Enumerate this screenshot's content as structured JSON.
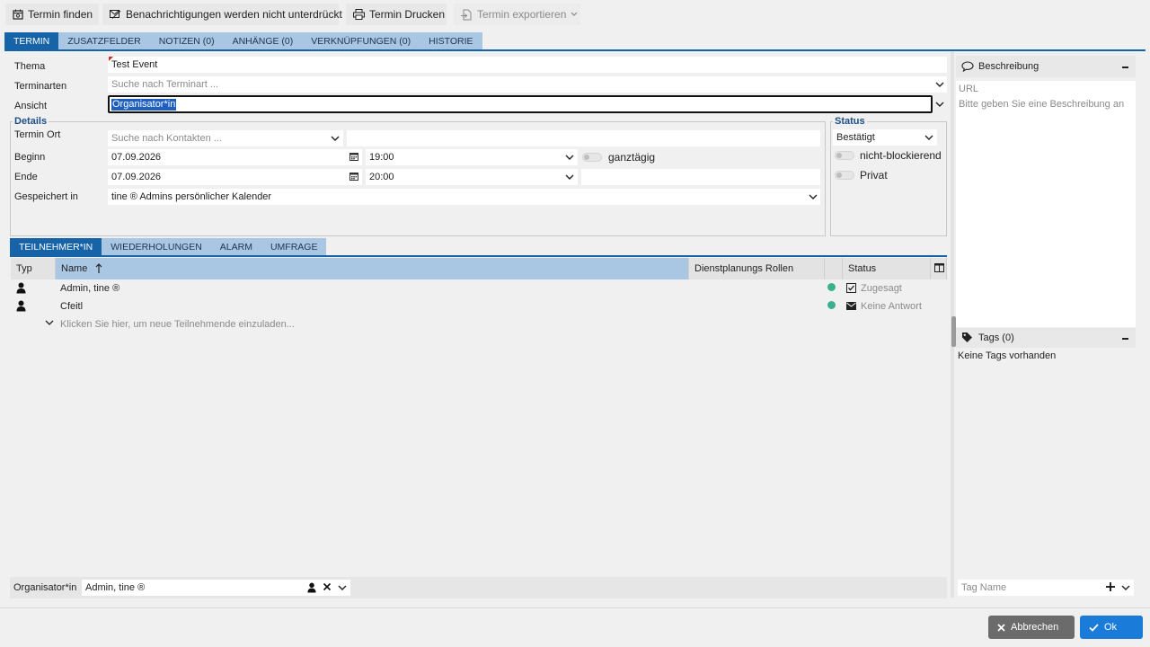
{
  "toolbar": {
    "find_label": "Termin finden",
    "notify_label": "Benachrichtigungen werden nicht unterdrückt",
    "print_label": "Termin Drucken",
    "export_label": "Termin exportieren"
  },
  "tabs": [
    "TERMIN",
    "ZUSATZFELDER",
    "NOTIZEN (0)",
    "ANHÄNGE (0)",
    "VERKNÜPFUNGEN (0)",
    "HISTORIE"
  ],
  "form": {
    "thema_label": "Thema",
    "thema_value": "Test Event",
    "terminarten_label": "Terminarten",
    "terminarten_placeholder": "Suche nach Terminart ...",
    "ansicht_label": "Ansicht",
    "ansicht_value": "Organisator*in"
  },
  "details": {
    "legend": "Details",
    "ort_label": "Termin Ort",
    "ort_placeholder": "Suche nach Kontakten ...",
    "beginn_label": "Beginn",
    "beginn_date": "07.09.2026",
    "beginn_time": "19:00",
    "allday_label": "ganztägig",
    "ende_label": "Ende",
    "ende_date": "07.09.2026",
    "ende_time": "20:00",
    "saved_label": "Gespeichert in",
    "saved_value": "tine ® Admins persönlicher Kalender"
  },
  "status": {
    "legend": "Status",
    "value": "Bestätigt",
    "nonblocking_label": "nicht-blockierend",
    "private_label": "Privat"
  },
  "subtabs": [
    "TEILNEHMER*IN",
    "WIEDERHOLUNGEN",
    "ALARM",
    "UMFRAGE"
  ],
  "attendees": {
    "headers": {
      "type": "Typ",
      "name": "Name",
      "roles": "Dienstplanungs Rollen",
      "status": "Status"
    },
    "rows": [
      {
        "name": "Admin, tine ®",
        "status": "Zugesagt"
      },
      {
        "name": "Cfeitl",
        "status": "Keine Antwort"
      }
    ],
    "invite_hint": "Klicken Sie hier, um neue Teilnehmende einzuladen..."
  },
  "organizer": {
    "label": "Organisator*in",
    "value": "Admin, tine ®"
  },
  "sidebar": {
    "description_title": "Beschreibung",
    "url_placeholder": "URL",
    "description_placeholder": "Bitte geben Sie eine Beschreibung an",
    "tags_title": "Tags (0)",
    "no_tags": "Keine Tags vorhanden",
    "tag_placeholder": "Tag Name"
  },
  "footer": {
    "cancel_label": "Abbrechen",
    "ok_label": "Ok"
  },
  "colors": {
    "accent": "#1663a8",
    "tab_inactive": "#a9c7e2",
    "status_dot": "#3bb08f",
    "cancel_button": "#6b6b6b",
    "ok_button": "#1a7cd8"
  }
}
